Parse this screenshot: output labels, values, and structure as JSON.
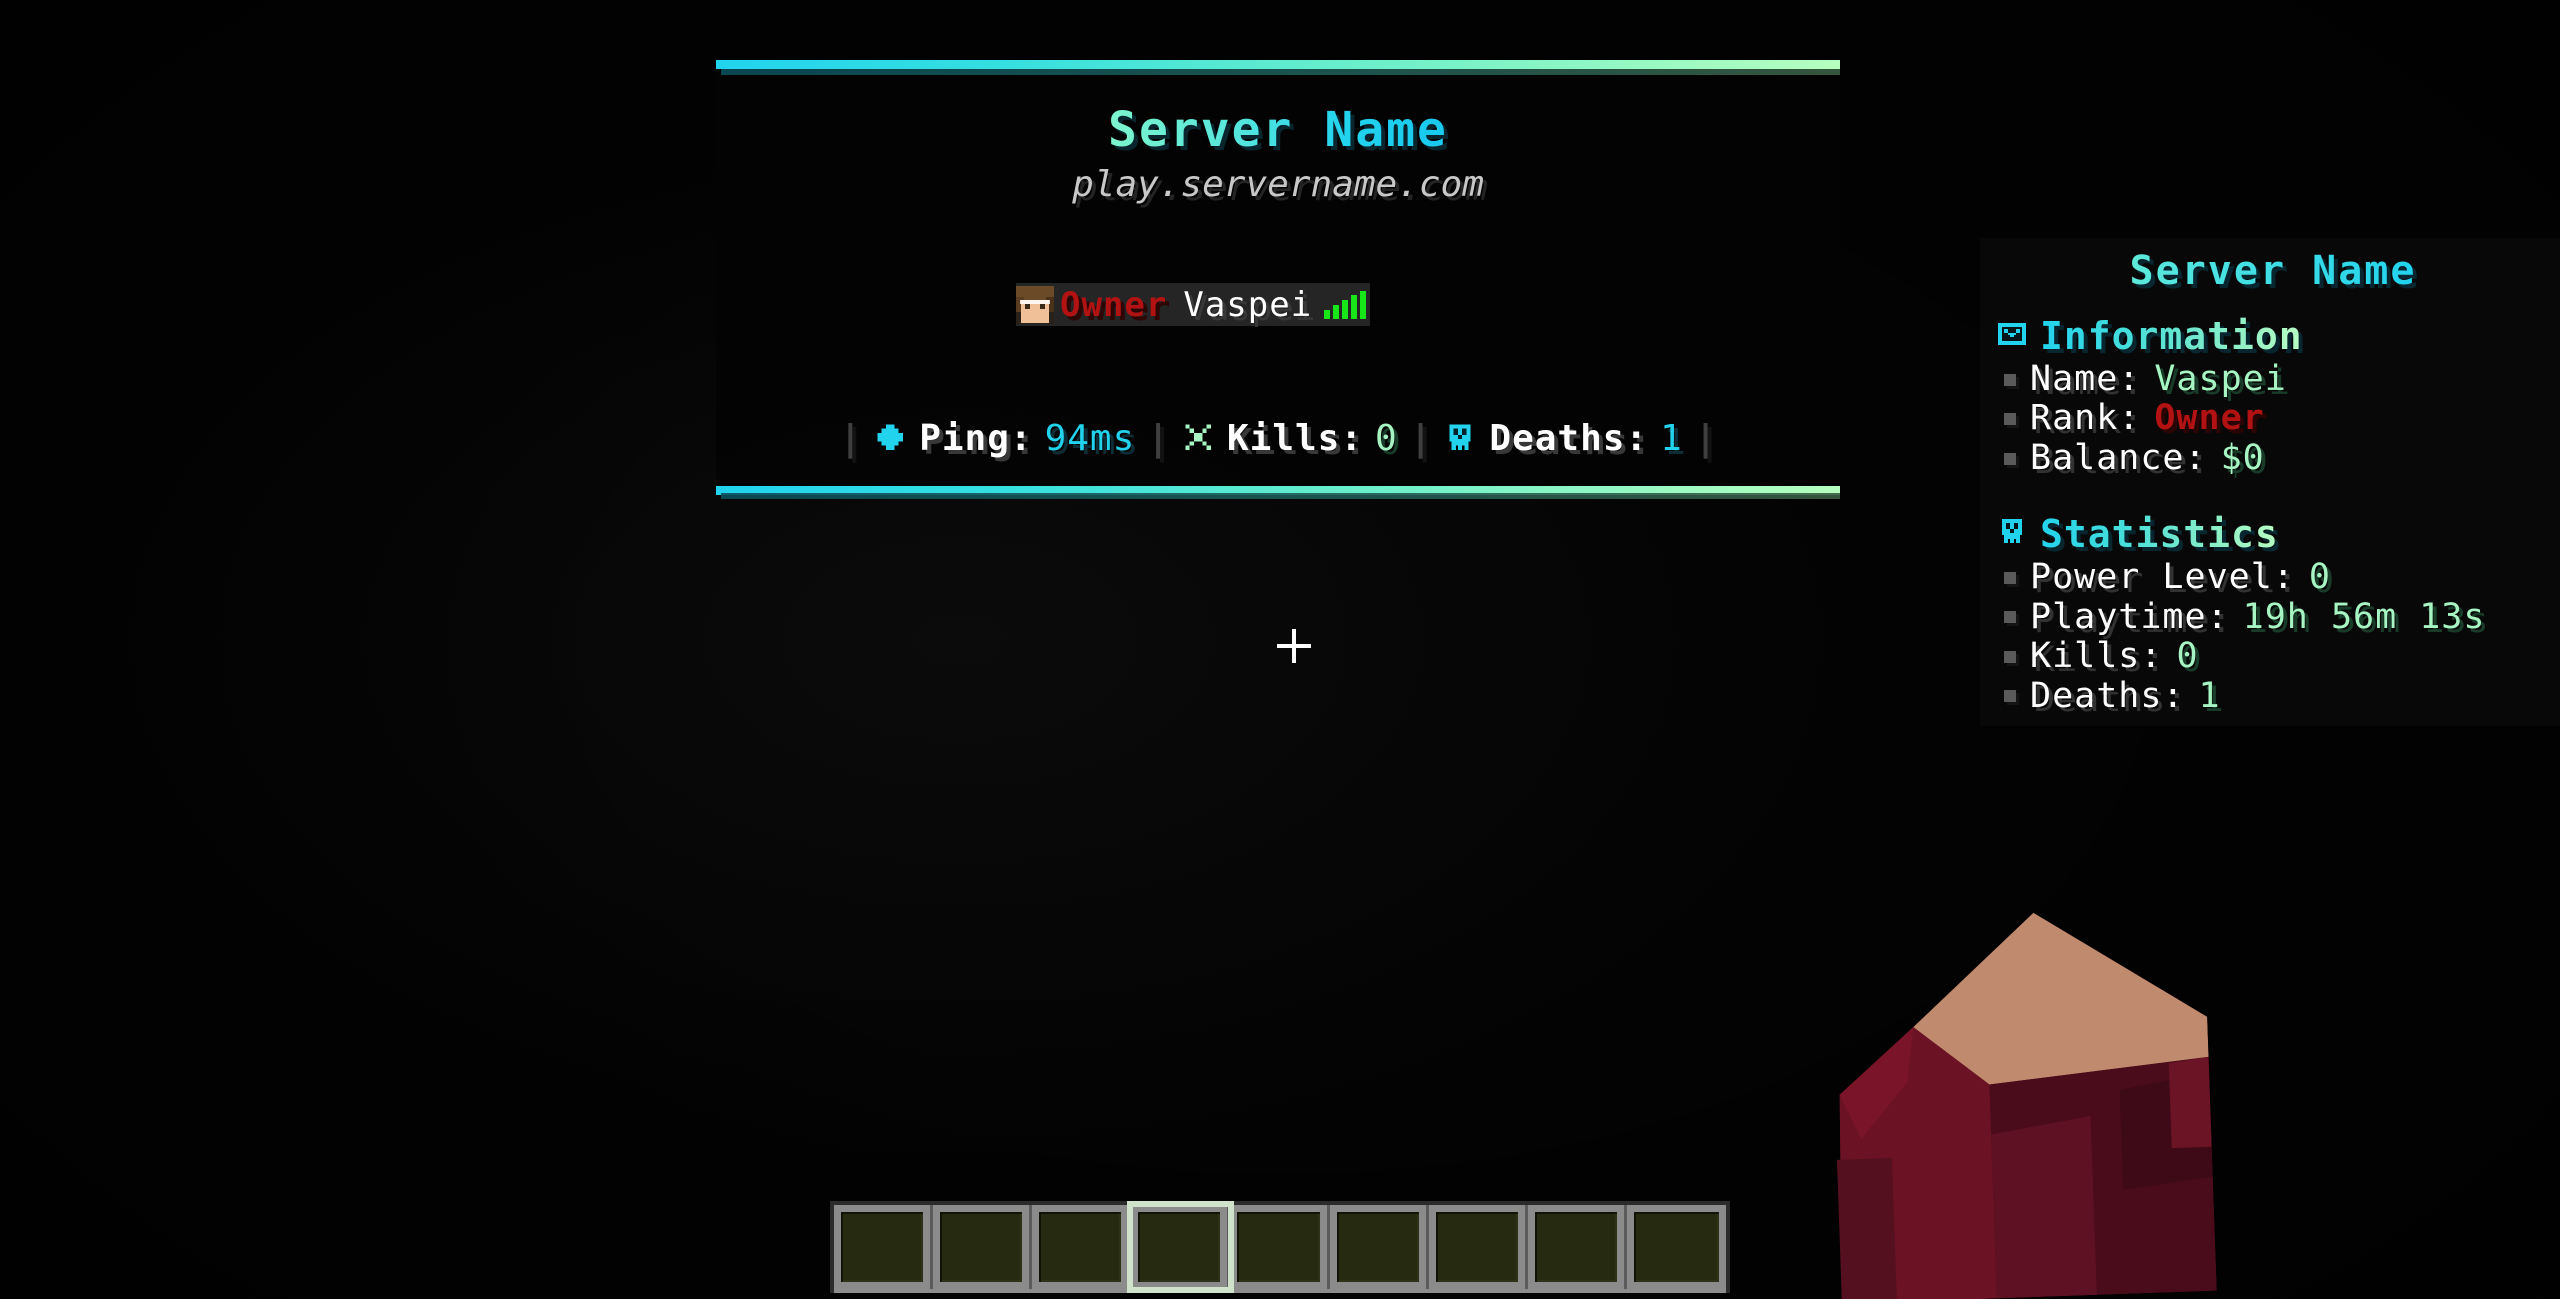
{
  "tablist": {
    "header": {
      "server_name": "Server Name",
      "server_ip": "play.servername.com"
    },
    "player": {
      "rank": "Owner",
      "name": "Vaspei",
      "avatar_icon": "player-head-icon",
      "connection_icon": "signal-bars-icon"
    },
    "footer": {
      "separator": "|",
      "stats": [
        {
          "icon": "ping-cross-icon",
          "label": "Ping:",
          "value": "94ms",
          "value_color": "#22d3ee"
        },
        {
          "icon": "crossed-swords-icon",
          "label": "Kills:",
          "value": "0",
          "value_color": "#a6f5c2"
        },
        {
          "icon": "skull-icon",
          "label": "Deaths:",
          "value": "1",
          "value_color": "#22d3ee"
        }
      ]
    }
  },
  "scoreboard": {
    "title": "Server Name",
    "sections": [
      {
        "icon": "envelope-icon",
        "heading": "Information",
        "rows": [
          {
            "label": "Name:",
            "value": "Vaspei",
            "style": "green"
          },
          {
            "label": "Rank:",
            "value": "Owner",
            "style": "rank"
          },
          {
            "label": "Balance:",
            "value": "$0",
            "style": "green"
          }
        ]
      },
      {
        "icon": "skull-stats-icon",
        "heading": "Statistics",
        "rows": [
          {
            "label": "Power Level:",
            "value": "0",
            "style": "green"
          },
          {
            "label": "Playtime:",
            "value": "19h 56m 13s",
            "style": "green"
          },
          {
            "label": "Kills:",
            "value": "0",
            "style": "green"
          },
          {
            "label": "Deaths:",
            "value": "1",
            "style": "green"
          }
        ]
      }
    ]
  },
  "hud": {
    "crosshair_icon": "crosshair-icon",
    "hand_icon": "player-arm-first-person"
  },
  "hotbar": {
    "slot_count": 9,
    "selected_slot": 4,
    "slots": [
      "",
      "",
      "",
      "",
      "",
      "",
      "",
      "",
      ""
    ]
  },
  "colors": {
    "accent_cyan": "#22d3ee",
    "accent_green": "#a6f5c2",
    "rank_red": "#b31212",
    "text_white": "#ffffff",
    "bullet_gray": "#5a5a5a",
    "signal_green": "#17e619",
    "background": "#040404"
  }
}
